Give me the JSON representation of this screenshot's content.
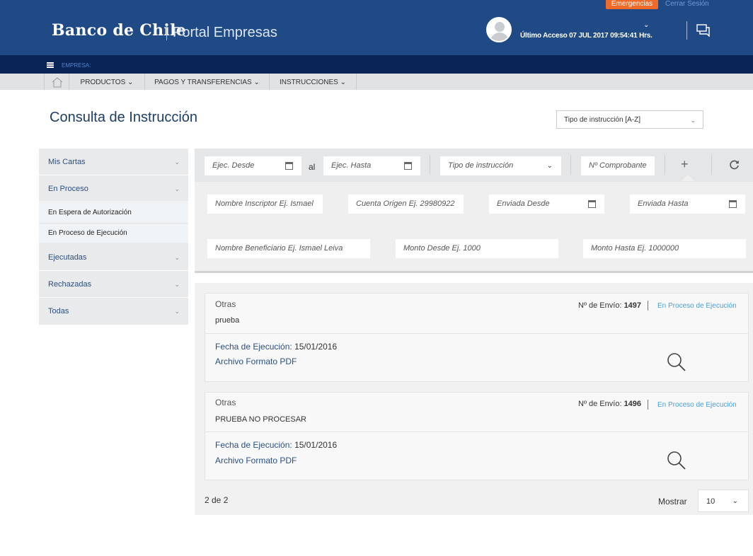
{
  "header": {
    "brand": "Banco de Chile",
    "portal": "Portal Empresas",
    "emergencias": "Emergencias",
    "cerrar_sesion": "Cerrar Sesión",
    "last_access": "Último Acceso 07 JUL 2017 09:54:41 Hrs."
  },
  "empresa_bar": {
    "label": "EMPRESA:"
  },
  "nav": {
    "items": [
      {
        "label": "PRODUCTOS"
      },
      {
        "label": "PAGOS Y TRANSFERENCIAS"
      },
      {
        "label": "INSTRUCCIONES"
      }
    ]
  },
  "page": {
    "title": "Consulta de Instrucción",
    "sort_select": "Tipo de instrucción [A-Z]"
  },
  "sidebar": {
    "mis_cartas": "Mis Cartas",
    "en_proceso": "En Proceso",
    "sub_espera": "En Espera de Autorización",
    "sub_ejecucion": "En Proceso de Ejecución",
    "ejecutadas": "Ejecutadas",
    "rechazadas": "Rechazadas",
    "todas": "Todas"
  },
  "filters": {
    "ejec_desde": "Ejec. Desde",
    "al": "al",
    "ejec_hasta": "Ejec. Hasta",
    "tipo_instruccion": "Tipo de instrucción",
    "comprobante": "Nº Comprobante",
    "nombre_inscriptor": "Nombre Inscriptor Ej. Ismael",
    "cuenta_origen": "Cuenta Origen Ej. 29980922",
    "enviada_desde": "Enviada Desde",
    "enviada_hasta": "Enviada Hasta",
    "nombre_beneficiario": "Nombre Beneficiario Ej. Ismael Leiva",
    "monto_desde": "Monto Desde Ej. 1000",
    "monto_hasta": "Monto Hasta Ej. 1000000"
  },
  "results": [
    {
      "category": "Otras",
      "description": "prueba",
      "envio_label": "Nº de Envío:",
      "envio_num": "1497",
      "status": "En Proceso de Ejecución",
      "fecha_label": "Fecha de Ejecución:",
      "fecha_value": "15/01/2016",
      "archivo": "Archivo Formato PDF"
    },
    {
      "category": "Otras",
      "description": "PRUEBA NO PROCESAR",
      "envio_label": "Nº de Envío:",
      "envio_num": "1496",
      "status": "En Proceso de Ejecución",
      "fecha_label": "Fecha de Ejecución:",
      "fecha_value": "15/01/2016",
      "archivo": "Archivo Formato PDF"
    }
  ],
  "pagination": {
    "count": "2 de 2",
    "mostrar_label": "Mostrar",
    "mostrar_value": "10"
  }
}
